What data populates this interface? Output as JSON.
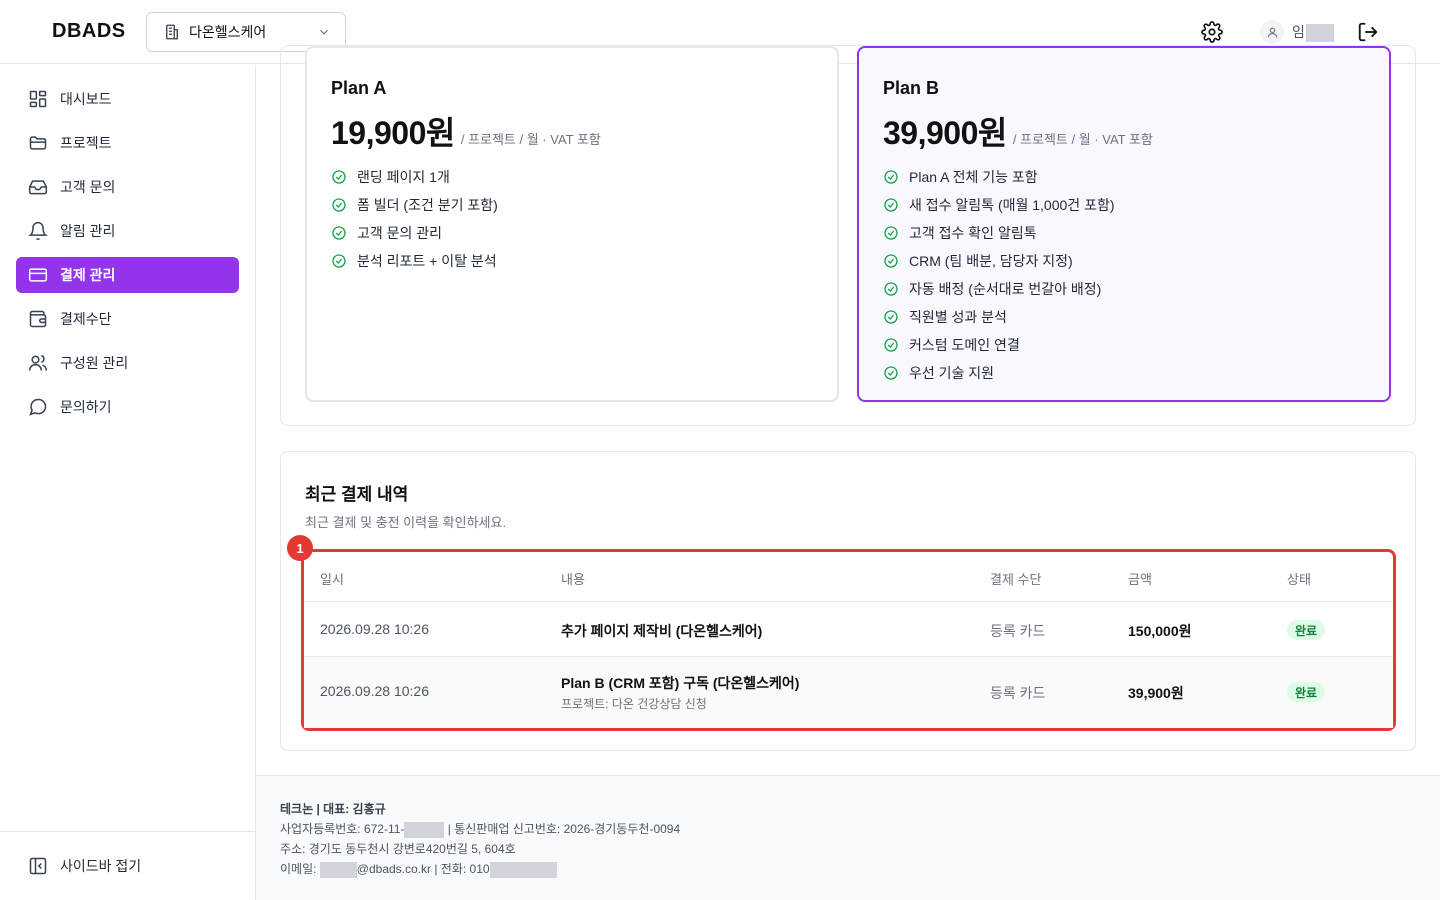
{
  "header": {
    "logo": "DBADS",
    "project_select": "다온헬스케어",
    "user_name": "임"
  },
  "sidebar": {
    "items": [
      {
        "label": "대시보드",
        "icon": "dashboard-icon"
      },
      {
        "label": "프로젝트",
        "icon": "folder-icon"
      },
      {
        "label": "고객 문의",
        "icon": "inbox-icon"
      },
      {
        "label": "알림 관리",
        "icon": "bell-icon"
      },
      {
        "label": "결제 관리",
        "icon": "credit-card-icon",
        "active": true
      },
      {
        "label": "결제수단",
        "icon": "wallet-icon"
      },
      {
        "label": "구성원 관리",
        "icon": "users-icon"
      },
      {
        "label": "문의하기",
        "icon": "message-icon"
      }
    ],
    "collapse_label": "사이드바 접기"
  },
  "plans": [
    {
      "name": "Plan A",
      "price": "19,900원",
      "unit": "/ 프로젝트 / 월 · VAT 포함",
      "features": [
        "랜딩 페이지 1개",
        "폼 빌더 (조건 분기 포함)",
        "고객 문의 관리",
        "분석 리포트 + 이탈 분석"
      ]
    },
    {
      "name": "Plan B",
      "price": "39,900원",
      "unit": "/ 프로젝트 / 월 · VAT 포함",
      "features": [
        "Plan A 전체 기능 포함",
        "새 접수 알림톡 (매월 1,000건 포함)",
        "고객 접수 확인 알림톡",
        "CRM (팀 배분, 담당자 지정)",
        "자동 배정 (순서대로 번갈아 배정)",
        "직원별 성과 분석",
        "커스텀 도메인 연결",
        "우선 기술 지원"
      ]
    }
  ],
  "history": {
    "title": "최근 결제 내역",
    "subtitle": "최근 결제 및 충전 이력을 확인하세요.",
    "badge": "1",
    "columns": [
      "일시",
      "내용",
      "결제 수단",
      "금액",
      "상태"
    ],
    "rows": [
      {
        "date": "2026.09.28 10:26",
        "desc": "추가 페이지 제작비 (다온헬스케어)",
        "sub": "",
        "method": "등록 카드",
        "amount": "150,000원",
        "status": "완료"
      },
      {
        "date": "2026.09.28 10:26",
        "desc": "Plan B (CRM 포함) 구독 (다온헬스케어)",
        "sub": "프로젝트: 다온 건강상담 신청",
        "method": "등록 카드",
        "amount": "39,900원",
        "status": "완료"
      }
    ]
  },
  "footer": {
    "company": "테크논 | 대표: 김홍규",
    "biz_prefix": "사업자등록번호: 672-11-",
    "biz_suffix": " | 통신판매업 신고번호: 2026-경기동두천-0094",
    "address": "주소: 경기도 동두천시 강변로420번길 5, 604호",
    "email_prefix": "이메일: ",
    "email_suffix": "@dbads.co.kr | 전화: 010"
  },
  "colors": {
    "accent": "#9333ea",
    "highlight": "#e53935",
    "success_bg": "#dcfce7",
    "success_text": "#15803d"
  }
}
